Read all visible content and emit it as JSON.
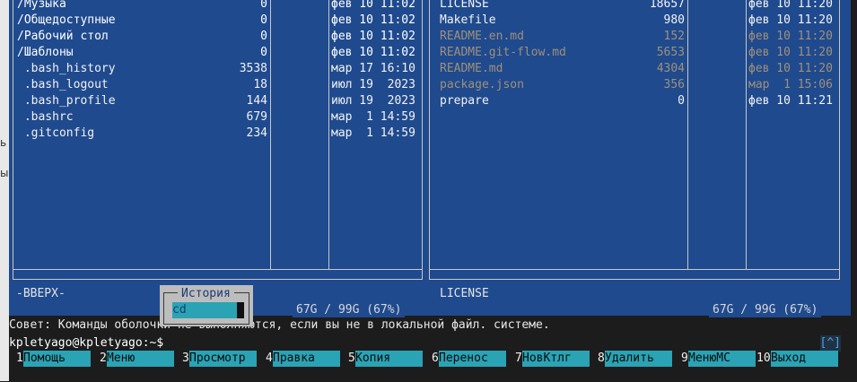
{
  "left_panel": {
    "rows": [
      {
        "name": "/Музыка",
        "size": "0",
        "date": "фев 10 11:02",
        "kind": "dir"
      },
      {
        "name": "/Общедоступные",
        "size": "0",
        "date": "фев 10 11:02",
        "kind": "dir"
      },
      {
        "name": "/Рабочий стол",
        "size": "0",
        "date": "фев 10 11:02",
        "kind": "dir"
      },
      {
        "name": "/Шаблоны",
        "size": "0",
        "date": "фев 10 11:02",
        "kind": "dir"
      },
      {
        "name": " .bash_history",
        "size": "3538",
        "date": "мар 17 16:10",
        "kind": "file"
      },
      {
        "name": " .bash_logout",
        "size": "18",
        "date": "июл 19  2023",
        "kind": "file"
      },
      {
        "name": " .bash_profile",
        "size": "144",
        "date": "июл 19  2023",
        "kind": "file"
      },
      {
        "name": " .bashrc",
        "size": "679",
        "date": "мар  1 14:59",
        "kind": "file"
      },
      {
        "name": " .gitconfig",
        "size": "234",
        "date": "мар  1 14:59",
        "kind": "file"
      }
    ],
    "mini_status": "-ВВЕРХ-",
    "free_space": "67G / 99G (67%)"
  },
  "right_panel": {
    "rows": [
      {
        "name": "LICENSE",
        "size": "18657",
        "date": "фев 10 11:20",
        "kind": "file"
      },
      {
        "name": "Makefile",
        "size": "980",
        "date": "фев 10 11:20",
        "kind": "file"
      },
      {
        "name": "README.en.md",
        "size": "152",
        "date": "фев 10 11:20",
        "kind": "dim"
      },
      {
        "name": "README.git-flow.md",
        "size": "5653",
        "date": "фев 10 11:20",
        "kind": "dim"
      },
      {
        "name": "README.md",
        "size": "4304",
        "date": "фев 10 11:20",
        "kind": "dim"
      },
      {
        "name": "package.json",
        "size": "356",
        "date": "мар  1 15:06",
        "kind": "dim"
      },
      {
        "name": "prepare",
        "size": "0",
        "date": "фев 10 11:21",
        "kind": "file"
      }
    ],
    "mini_status": "LICENSE",
    "free_space": "67G / 99G (67%)"
  },
  "hint": "Совет: Команды оболочки не выполняются, если вы не в локальной файл. системе.",
  "prompt": "kpletyago@kpletyago:~$",
  "caret_indicator": "[^]",
  "history_popup": {
    "title": "История",
    "selected": "cd"
  },
  "function_keys": [
    {
      "num": "1",
      "label": "Помощь"
    },
    {
      "num": "2",
      "label": "Меню"
    },
    {
      "num": "3",
      "label": "Просмотр"
    },
    {
      "num": "4",
      "label": "Правка"
    },
    {
      "num": "5",
      "label": "Копия"
    },
    {
      "num": "6",
      "label": "Перенос"
    },
    {
      "num": "7",
      "label": "НовКтлг"
    },
    {
      "num": "8",
      "label": "Удалить"
    },
    {
      "num": "9",
      "label": "МенюМС"
    },
    {
      "num": "10",
      "label": "Выход"
    }
  ],
  "desktop_strip": {
    "text_top": "ь",
    "text_bottom": "ы"
  },
  "colors": {
    "panel_bg": "#1f4a8e",
    "key_bg": "#2aa3b5",
    "dim_file": "#a0907a"
  }
}
